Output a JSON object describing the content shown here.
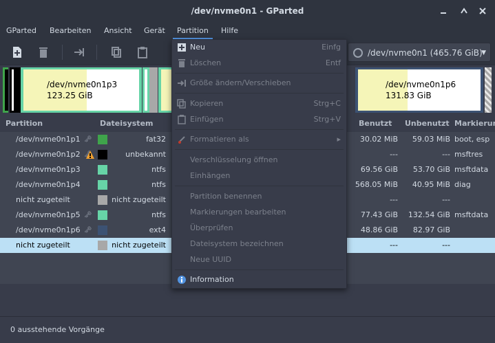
{
  "window": {
    "title": "/dev/nvme0n1 - GParted"
  },
  "menubar": {
    "items": [
      "GParted",
      "Bearbeiten",
      "Ansicht",
      "Gerät",
      "Partition",
      "Hilfe"
    ]
  },
  "toolbar": {
    "device_selector": "/dev/nvme0n1 (465.76 GiB)"
  },
  "graph": {
    "nvme0n1p3": {
      "name": "/dev/nvme0n1p3",
      "size": "123.25 GiB"
    },
    "nvme0n1p6": {
      "name": "/dev/nvme0n1p6",
      "size": "131.83 GiB"
    }
  },
  "table": {
    "headers": {
      "partition": "Partition",
      "filesystem": "Dateisystem",
      "used": "Benutzt",
      "unused": "Unbenutzt",
      "flags": "Markierungen"
    },
    "rows": [
      {
        "partition": "/dev/nvme0n1p1",
        "filesystem": "fat32",
        "used": "30.02 MiB",
        "unused": "59.03 MiB",
        "flags": "boot, esp",
        "color": "#3fa44b",
        "key": true
      },
      {
        "partition": "/dev/nvme0n1p2",
        "filesystem": "unbekannt",
        "used": "---",
        "unused": "---",
        "flags": "msftres",
        "color": "#000000",
        "warn": true,
        "key": true
      },
      {
        "partition": "/dev/nvme0n1p3",
        "filesystem": "ntfs",
        "used": "69.56 GiB",
        "unused": "53.70 GiB",
        "flags": "msftdata",
        "color": "#67d4a7"
      },
      {
        "partition": "/dev/nvme0n1p4",
        "filesystem": "ntfs",
        "used": "568.05 MiB",
        "unused": "40.95 MiB",
        "flags": "diag",
        "color": "#67d4a7"
      },
      {
        "partition": "nicht zugeteilt",
        "filesystem": "nicht zugeteilt",
        "used": "---",
        "unused": "---",
        "flags": "",
        "color": "#a8a8a8"
      },
      {
        "partition": "/dev/nvme0n1p5",
        "filesystem": "ntfs",
        "used": "77.43 GiB",
        "unused": "132.54 GiB",
        "flags": "msftdata",
        "color": "#67d4a7",
        "key": true
      },
      {
        "partition": "/dev/nvme0n1p6",
        "filesystem": "ext4",
        "used": "48.86 GiB",
        "unused": "82.97 GiB",
        "flags": "",
        "color": "#3c5273",
        "key": true
      },
      {
        "partition": "nicht zugeteilt",
        "filesystem": "nicht zugeteilt",
        "used": "---",
        "unused": "---",
        "flags": "",
        "color": "#a8a8a8",
        "selected": true
      }
    ]
  },
  "status": {
    "text": "0 ausstehende Vorgänge"
  },
  "partition_menu": {
    "items": [
      {
        "label": "Neu",
        "accel": "Einfg",
        "enabled": true,
        "icon": "new-icon"
      },
      {
        "label": "Löschen",
        "accel": "Entf",
        "enabled": false,
        "icon": "delete-icon"
      },
      {
        "label": "Größe ändern/Verschieben",
        "accel": "",
        "enabled": false,
        "icon": "resize-icon"
      },
      {
        "label": "Kopieren",
        "accel": "Strg+C",
        "enabled": false,
        "icon": "copy-icon"
      },
      {
        "label": "Einfügen",
        "accel": "Strg+V",
        "enabled": false,
        "icon": "paste-icon"
      },
      {
        "label": "Formatieren als",
        "accel": "",
        "enabled": false,
        "icon": "format-icon",
        "submenu": true
      },
      {
        "label": "Verschlüsselung öffnen",
        "accel": "",
        "enabled": false
      },
      {
        "label": "Einhängen",
        "accel": "",
        "enabled": false
      },
      {
        "label": "Partition benennen",
        "accel": "",
        "enabled": false
      },
      {
        "label": "Markierungen bearbeiten",
        "accel": "",
        "enabled": false
      },
      {
        "label": "Überprüfen",
        "accel": "",
        "enabled": false
      },
      {
        "label": "Dateisystem bezeichnen",
        "accel": "",
        "enabled": false
      },
      {
        "label": "Neue UUID",
        "accel": "",
        "enabled": false
      },
      {
        "label": "Information",
        "accel": "",
        "enabled": true,
        "icon": "info-icon"
      }
    ]
  },
  "colors": {
    "accent": "#5294e2",
    "selected_row": "#bce0f5",
    "ntfs": "#67d4a7",
    "ext4": "#3c5273",
    "fat32": "#3fa44b",
    "unallocated": "#a8a8a8"
  }
}
